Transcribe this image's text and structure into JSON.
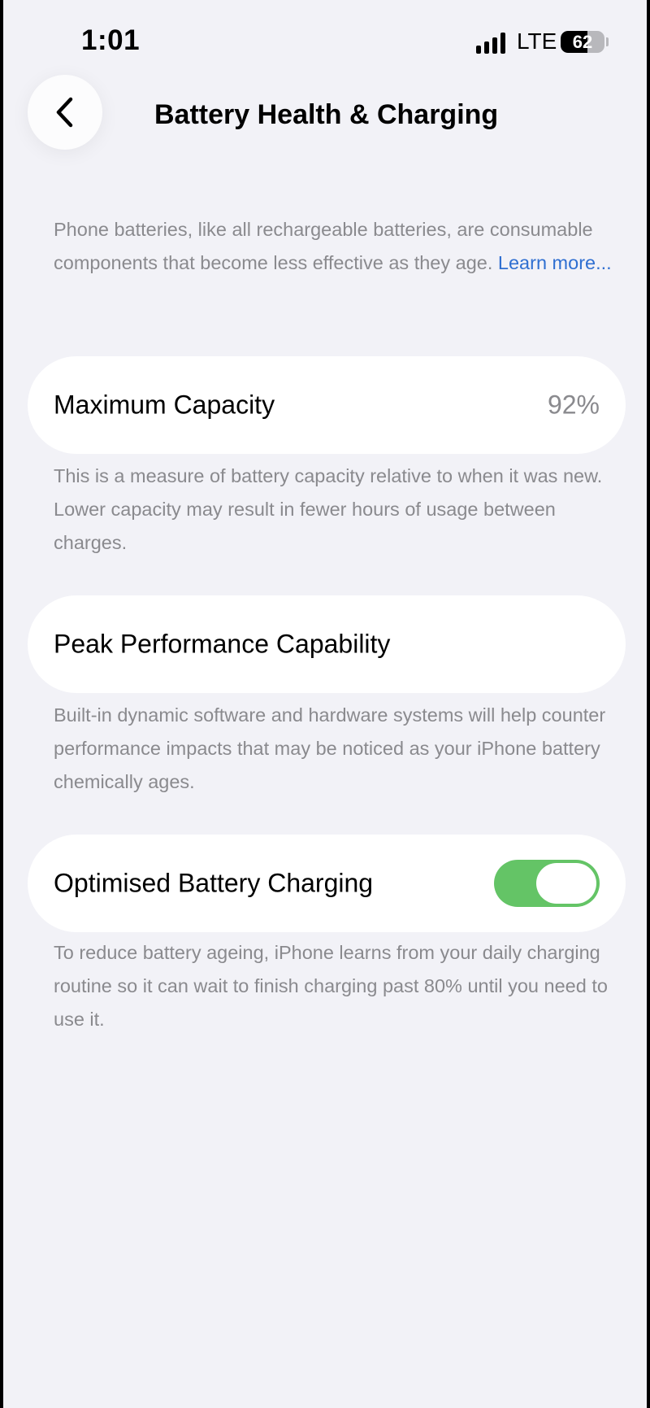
{
  "status_bar": {
    "time": "1:01",
    "network": "LTE",
    "battery_percent": "62",
    "battery_level": 0.62,
    "signal_bars": 4
  },
  "nav": {
    "back_icon": "chevron-left-icon",
    "title": "Battery Health & Charging"
  },
  "intro": {
    "text": "Phone batteries, like all rechargeable batteries, are consumable components that become less effective as they age. ",
    "link": "Learn more..."
  },
  "max_capacity": {
    "label": "Maximum Capacity",
    "value": "92%",
    "description": "This is a measure of battery capacity relative to when it was new. Lower capacity may result in fewer hours of usage between charges."
  },
  "peak_performance": {
    "label": "Peak Performance Capability",
    "description": "Built-in dynamic software and hardware systems will help counter performance impacts that may be noticed as your iPhone battery chemically ages."
  },
  "optimised_charging": {
    "label": "Optimised Battery Charging",
    "enabled": true,
    "description": "To reduce battery ageing, iPhone learns from your daily charging routine so it can wait to finish charging past 80% until you need to use it."
  },
  "colors": {
    "background": "#f2f2f7",
    "card": "#ffffff",
    "secondary_text": "#8a8a8e",
    "link": "#2f6fd1",
    "toggle_on": "#64c466"
  }
}
